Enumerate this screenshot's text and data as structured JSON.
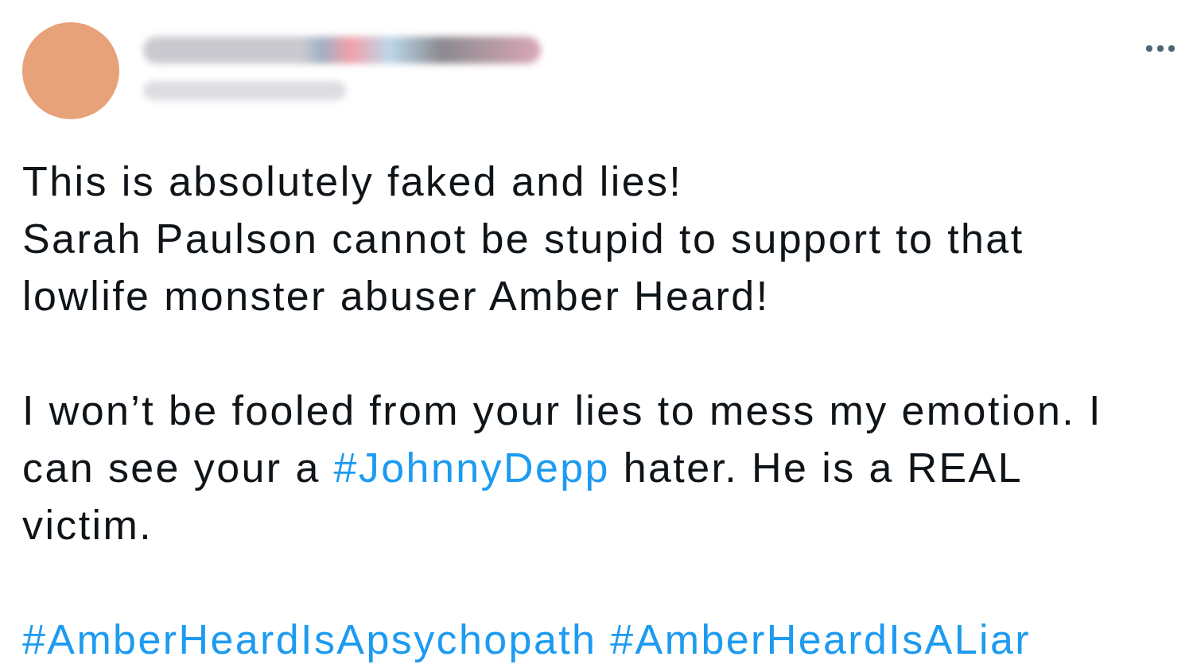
{
  "tweet": {
    "paragraphs": [
      [
        [
          {
            "kind": "text",
            "text": "This is absolutely faked and lies!"
          }
        ],
        [
          {
            "kind": "text",
            "text": "Sarah Paulson cannot be stupid to support to that"
          }
        ],
        [
          {
            "kind": "text",
            "text": "lowlife monster abuser Amber Heard!"
          }
        ]
      ],
      [
        [
          {
            "kind": "text",
            "text": "I won’t be fooled from your lies to mess my emotion. I"
          }
        ],
        [
          {
            "kind": "text",
            "text": "can see your a "
          },
          {
            "kind": "hashtag",
            "text": "#JohnnyDepp"
          },
          {
            "kind": "text",
            "text": " hater. He is a REAL"
          }
        ],
        [
          {
            "kind": "text",
            "text": "victim."
          }
        ]
      ],
      [
        [
          {
            "kind": "hashtag",
            "text": "#AmberHeardIsApsychopath"
          },
          {
            "kind": "hashtag",
            "text": "#AmberHeardIsALiar"
          }
        ]
      ]
    ]
  }
}
